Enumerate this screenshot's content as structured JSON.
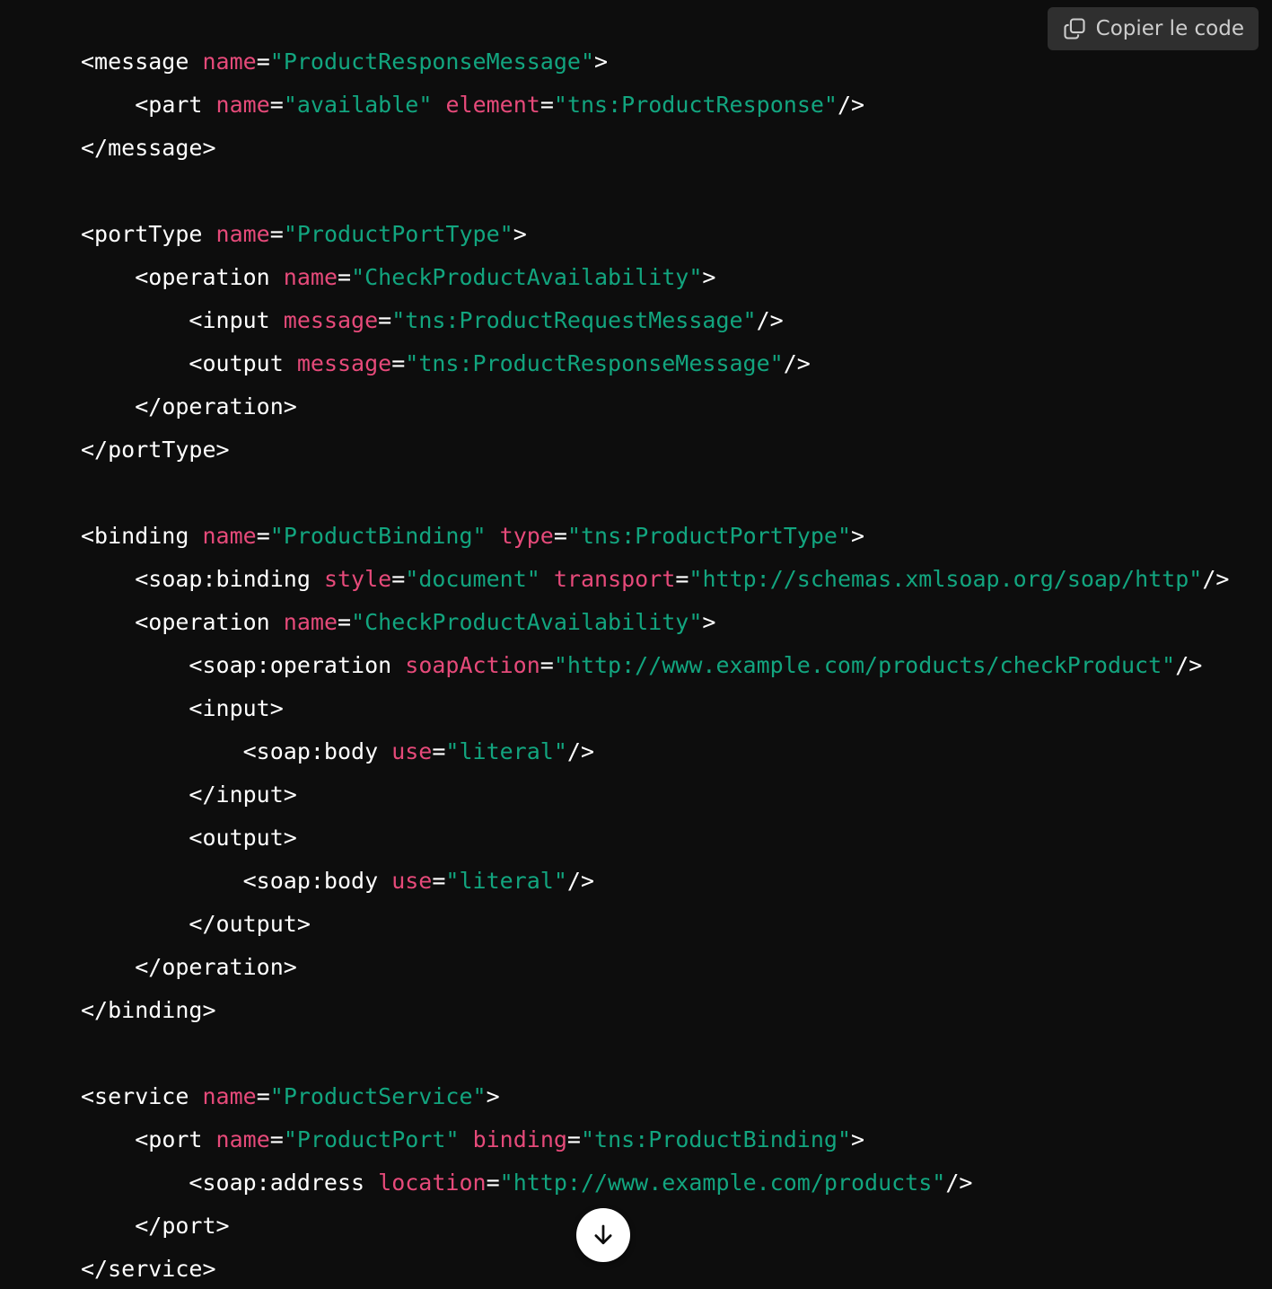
{
  "toolbar": {
    "copy_label": "Copier le code",
    "copy_icon": "copy-icon"
  },
  "scroll": {
    "icon": "arrow-down-icon"
  },
  "colors": {
    "background": "#0d0d0d",
    "tag": "#ffffff",
    "attribute": "#e64a7a",
    "string": "#12a57f",
    "button_bg": "#2f2f2f"
  },
  "code": {
    "lines": [
      [
        [
          "tag",
          "<message"
        ],
        [
          "sp",
          " "
        ],
        [
          "attr",
          "name"
        ],
        [
          "eq",
          "="
        ],
        [
          "str",
          "\"ProductResponseMessage\""
        ],
        [
          "tag",
          ">"
        ]
      ],
      [
        [
          "sp",
          "    "
        ],
        [
          "tag",
          "<part"
        ],
        [
          "sp",
          " "
        ],
        [
          "attr",
          "name"
        ],
        [
          "eq",
          "="
        ],
        [
          "str",
          "\"available\""
        ],
        [
          "sp",
          " "
        ],
        [
          "attr",
          "element"
        ],
        [
          "eq",
          "="
        ],
        [
          "str",
          "\"tns:ProductResponse\""
        ],
        [
          "tag",
          "/>"
        ]
      ],
      [
        [
          "tag",
          "</message>"
        ]
      ],
      [],
      [
        [
          "tag",
          "<portType"
        ],
        [
          "sp",
          " "
        ],
        [
          "attr",
          "name"
        ],
        [
          "eq",
          "="
        ],
        [
          "str",
          "\"ProductPortType\""
        ],
        [
          "tag",
          ">"
        ]
      ],
      [
        [
          "sp",
          "    "
        ],
        [
          "tag",
          "<operation"
        ],
        [
          "sp",
          " "
        ],
        [
          "attr",
          "name"
        ],
        [
          "eq",
          "="
        ],
        [
          "str",
          "\"CheckProductAvailability\""
        ],
        [
          "tag",
          ">"
        ]
      ],
      [
        [
          "sp",
          "        "
        ],
        [
          "tag",
          "<input"
        ],
        [
          "sp",
          " "
        ],
        [
          "attr",
          "message"
        ],
        [
          "eq",
          "="
        ],
        [
          "str",
          "\"tns:ProductRequestMessage\""
        ],
        [
          "tag",
          "/>"
        ]
      ],
      [
        [
          "sp",
          "        "
        ],
        [
          "tag",
          "<output"
        ],
        [
          "sp",
          " "
        ],
        [
          "attr",
          "message"
        ],
        [
          "eq",
          "="
        ],
        [
          "str",
          "\"tns:ProductResponseMessage\""
        ],
        [
          "tag",
          "/>"
        ]
      ],
      [
        [
          "sp",
          "    "
        ],
        [
          "tag",
          "</operation>"
        ]
      ],
      [
        [
          "tag",
          "</portType>"
        ]
      ],
      [],
      [
        [
          "tag",
          "<binding"
        ],
        [
          "sp",
          " "
        ],
        [
          "attr",
          "name"
        ],
        [
          "eq",
          "="
        ],
        [
          "str",
          "\"ProductBinding\""
        ],
        [
          "sp",
          " "
        ],
        [
          "attr",
          "type"
        ],
        [
          "eq",
          "="
        ],
        [
          "str",
          "\"tns:ProductPortType\""
        ],
        [
          "tag",
          ">"
        ]
      ],
      [
        [
          "sp",
          "    "
        ],
        [
          "tag",
          "<soap:binding"
        ],
        [
          "sp",
          " "
        ],
        [
          "attr",
          "style"
        ],
        [
          "eq",
          "="
        ],
        [
          "str",
          "\"document\""
        ],
        [
          "sp",
          " "
        ],
        [
          "attr",
          "transport"
        ],
        [
          "eq",
          "="
        ],
        [
          "str",
          "\"http://schemas.xmlsoap.org/soap/http\""
        ],
        [
          "tag",
          "/>"
        ]
      ],
      [
        [
          "sp",
          "    "
        ],
        [
          "tag",
          "<operation"
        ],
        [
          "sp",
          " "
        ],
        [
          "attr",
          "name"
        ],
        [
          "eq",
          "="
        ],
        [
          "str",
          "\"CheckProductAvailability\""
        ],
        [
          "tag",
          ">"
        ]
      ],
      [
        [
          "sp",
          "        "
        ],
        [
          "tag",
          "<soap:operation"
        ],
        [
          "sp",
          " "
        ],
        [
          "attr",
          "soapAction"
        ],
        [
          "eq",
          "="
        ],
        [
          "str",
          "\"http://www.example.com/products/checkProduct\""
        ],
        [
          "tag",
          "/>"
        ]
      ],
      [
        [
          "sp",
          "        "
        ],
        [
          "tag",
          "<input>"
        ]
      ],
      [
        [
          "sp",
          "            "
        ],
        [
          "tag",
          "<soap:body"
        ],
        [
          "sp",
          " "
        ],
        [
          "attr",
          "use"
        ],
        [
          "eq",
          "="
        ],
        [
          "str",
          "\"literal\""
        ],
        [
          "tag",
          "/>"
        ]
      ],
      [
        [
          "sp",
          "        "
        ],
        [
          "tag",
          "</input>"
        ]
      ],
      [
        [
          "sp",
          "        "
        ],
        [
          "tag",
          "<output>"
        ]
      ],
      [
        [
          "sp",
          "            "
        ],
        [
          "tag",
          "<soap:body"
        ],
        [
          "sp",
          " "
        ],
        [
          "attr",
          "use"
        ],
        [
          "eq",
          "="
        ],
        [
          "str",
          "\"literal\""
        ],
        [
          "tag",
          "/>"
        ]
      ],
      [
        [
          "sp",
          "        "
        ],
        [
          "tag",
          "</output>"
        ]
      ],
      [
        [
          "sp",
          "    "
        ],
        [
          "tag",
          "</operation>"
        ]
      ],
      [
        [
          "tag",
          "</binding>"
        ]
      ],
      [],
      [
        [
          "tag",
          "<service"
        ],
        [
          "sp",
          " "
        ],
        [
          "attr",
          "name"
        ],
        [
          "eq",
          "="
        ],
        [
          "str",
          "\"ProductService\""
        ],
        [
          "tag",
          ">"
        ]
      ],
      [
        [
          "sp",
          "    "
        ],
        [
          "tag",
          "<port"
        ],
        [
          "sp",
          " "
        ],
        [
          "attr",
          "name"
        ],
        [
          "eq",
          "="
        ],
        [
          "str",
          "\"ProductPort\""
        ],
        [
          "sp",
          " "
        ],
        [
          "attr",
          "binding"
        ],
        [
          "eq",
          "="
        ],
        [
          "str",
          "\"tns:ProductBinding\""
        ],
        [
          "tag",
          ">"
        ]
      ],
      [
        [
          "sp",
          "        "
        ],
        [
          "tag",
          "<soap:address"
        ],
        [
          "sp",
          " "
        ],
        [
          "attr",
          "location"
        ],
        [
          "eq",
          "="
        ],
        [
          "str",
          "\"http://www.example.com/products\""
        ],
        [
          "tag",
          "/>"
        ]
      ],
      [
        [
          "sp",
          "    "
        ],
        [
          "tag",
          "</port>"
        ]
      ],
      [
        [
          "tag",
          "</service>"
        ]
      ]
    ]
  }
}
